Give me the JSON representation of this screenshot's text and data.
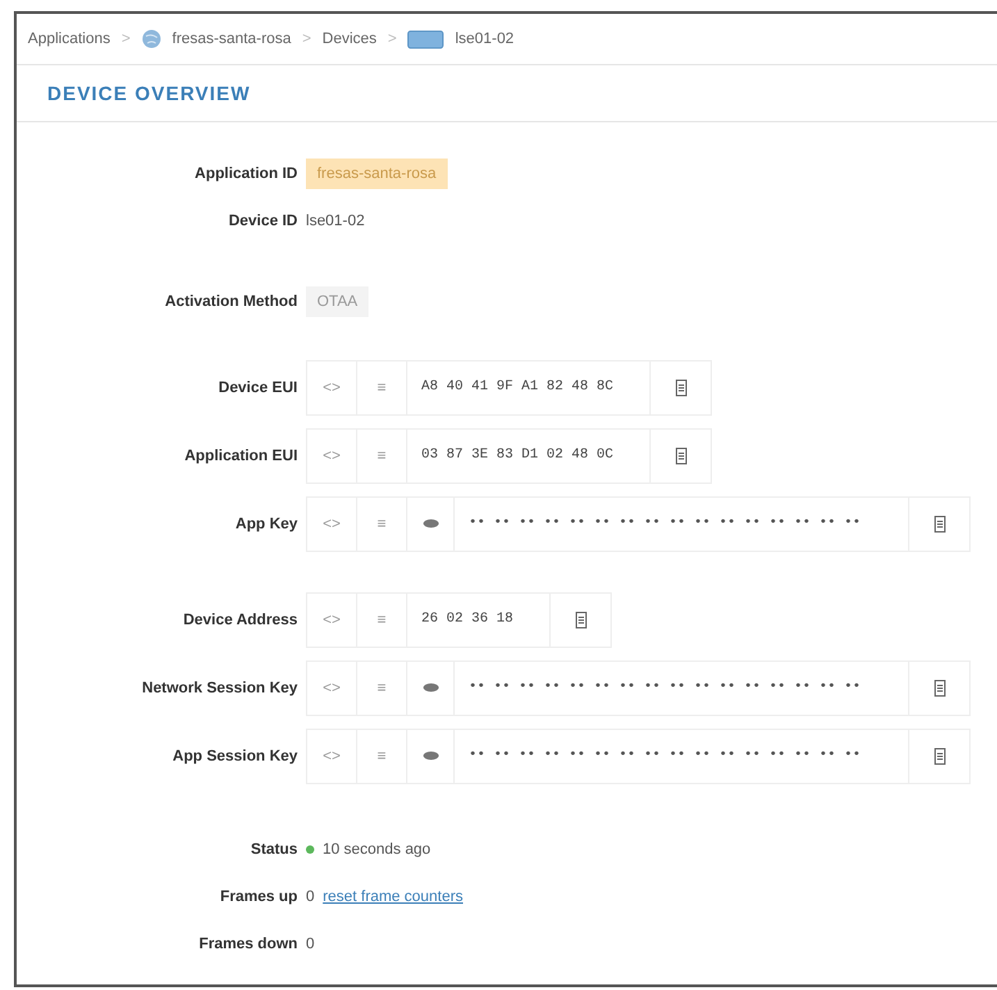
{
  "breadcrumb": [
    {
      "label": "Applications",
      "kind": "section"
    },
    {
      "label": "fresas-santa-rosa",
      "kind": "application"
    },
    {
      "label": "Devices",
      "kind": "section"
    },
    {
      "label": "lse01-02",
      "kind": "device"
    }
  ],
  "breadcrumb_separator": ">",
  "title": "DEVICE OVERVIEW",
  "info": [
    {
      "label": "Application ID",
      "value": "fresas-santa-rosa",
      "kind": "tag"
    },
    {
      "label": "Device ID",
      "value": "lse01-02",
      "kind": "plain"
    }
  ],
  "activation": {
    "label": "Activation Method",
    "value": "OTAA"
  },
  "keys": [
    {
      "label": "Device EUI",
      "format": "<>",
      "order": "≡",
      "value": "A8 40 41 9F A1 82 48 8C",
      "kind": "plain"
    },
    {
      "label": "Application EUI",
      "format": "<>",
      "order": "≡",
      "value": "03 87 3E 83 D1 02 48 0C",
      "kind": "plain"
    },
    {
      "label": "App Key",
      "format": "<>",
      "order": "≡",
      "value": "•• •• •• •• •• •• •• •• •• •• •• •• •• •• •• ••",
      "kind": "secret"
    }
  ],
  "session_keys": [
    {
      "label": "Device Address",
      "format": "<>",
      "order": "≡",
      "value": "26 02 36 18",
      "kind": "plain"
    },
    {
      "label": "Network Session Key",
      "format": "<>",
      "order": "≡",
      "value": "•• •• •• •• •• •• •• •• •• •• •• •• •• •• •• ••",
      "kind": "secret"
    },
    {
      "label": "App Session Key",
      "format": "<>",
      "order": "≡",
      "value": "•• •• •• •• •• •• •• •• •• •• •• •• •• •• •• ••",
      "kind": "secret"
    }
  ],
  "status": {
    "label": "Status",
    "value": "10 seconds ago",
    "color": "#5cb85c"
  },
  "frames_up": {
    "label": "Frames up",
    "value": "0",
    "link": "reset frame counters"
  },
  "frames_down": {
    "label": "Frames down",
    "value": "0"
  }
}
